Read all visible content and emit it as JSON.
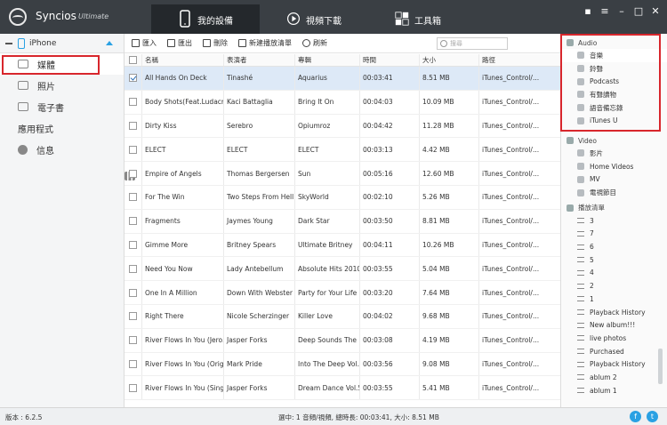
{
  "app": {
    "name": "Syncios",
    "edition": "Ultimate"
  },
  "tabs": [
    {
      "label": "我的設備",
      "icon": "phone-icon"
    },
    {
      "label": "視頻下載",
      "icon": "play-icon"
    },
    {
      "label": "工具箱",
      "icon": "toolbox-icon"
    }
  ],
  "window_controls": [
    "chat-icon",
    "menu-icon",
    "minimize-icon",
    "maximize-icon",
    "close-icon"
  ],
  "device": {
    "name": "iPhone"
  },
  "nav": [
    {
      "label": "媒體",
      "icon": "media-icon"
    },
    {
      "label": "照片",
      "icon": "photo-icon"
    },
    {
      "label": "電子書",
      "icon": "ebook-icon"
    },
    {
      "label": "應用程式",
      "icon": "apps-icon"
    },
    {
      "label": "信息",
      "icon": "info-icon"
    }
  ],
  "toolbar": {
    "import": "匯入",
    "export": "匯出",
    "delete": "刪除",
    "new_playlist": "新建播放清單",
    "refresh": "刷新"
  },
  "search": {
    "placeholder": "搜尋"
  },
  "columns": [
    "名稱",
    "表演者",
    "專輯",
    "時間",
    "大小",
    "路徑"
  ],
  "rows": [
    {
      "name": "All Hands On Deck",
      "artist": "Tinashé",
      "album": "Aquarius",
      "time": "00:03:41",
      "size": "8.51 MB",
      "path": "iTunes_Control/...",
      "checked": true
    },
    {
      "name": "Body Shots(Feat.Ludacr...",
      "artist": "Kaci Battaglia",
      "album": "Bring It On",
      "time": "00:04:03",
      "size": "10.09 MB",
      "path": "iTunes_Control/...",
      "checked": false
    },
    {
      "name": "Dirty Kiss",
      "artist": "Serebro",
      "album": "Opiumroz",
      "time": "00:04:42",
      "size": "11.28 MB",
      "path": "iTunes_Control/...",
      "checked": false
    },
    {
      "name": "ELECT",
      "artist": "ELECT",
      "album": "ELECT",
      "time": "00:03:13",
      "size": "4.42 MB",
      "path": "iTunes_Control/...",
      "checked": false
    },
    {
      "name": "Empire of Angels",
      "artist": "Thomas Bergersen",
      "album": "Sun",
      "time": "00:05:16",
      "size": "12.60 MB",
      "path": "iTunes_Control/...",
      "checked": false
    },
    {
      "name": "For The Win",
      "artist": "Two Steps From Hell",
      "album": "SkyWorld",
      "time": "00:02:10",
      "size": "5.26 MB",
      "path": "iTunes_Control/...",
      "checked": false
    },
    {
      "name": "Fragments",
      "artist": "Jaymes Young",
      "album": "Dark Star",
      "time": "00:03:50",
      "size": "8.81 MB",
      "path": "iTunes_Control/...",
      "checked": false
    },
    {
      "name": "Gimme More",
      "artist": "Britney Spears",
      "album": "Ultimate Britney",
      "time": "00:04:11",
      "size": "10.26 MB",
      "path": "iTunes_Control/...",
      "checked": false
    },
    {
      "name": "Need You Now",
      "artist": "Lady Antebellum",
      "album": "Absolute Hits 2010",
      "time": "00:03:55",
      "size": "5.04 MB",
      "path": "iTunes_Control/...",
      "checked": false
    },
    {
      "name": "One In A Million",
      "artist": "Down With Webster",
      "album": "Party for Your Life",
      "time": "00:03:20",
      "size": "7.64 MB",
      "path": "iTunes_Control/...",
      "checked": false
    },
    {
      "name": "Right There",
      "artist": "Nicole Scherzinger",
      "album": "Killer Love",
      "time": "00:04:02",
      "size": "9.68 MB",
      "path": "iTunes_Control/...",
      "checked": false
    },
    {
      "name": "River Flows In You (Jero...",
      "artist": "Jasper Forks",
      "album": "Deep Sounds The ...",
      "time": "00:03:08",
      "size": "4.19 MB",
      "path": "iTunes_Control/...",
      "checked": false
    },
    {
      "name": "River Flows In You (Orig...",
      "artist": "Mark Pride",
      "album": "Into The Deep Vol.02",
      "time": "00:03:56",
      "size": "9.08 MB",
      "path": "iTunes_Control/...",
      "checked": false
    },
    {
      "name": "River Flows In You (Sing...",
      "artist": "Jasper Forks",
      "album": "Dream Dance Vol.55",
      "time": "00:03:55",
      "size": "5.41 MB",
      "path": "iTunes_Control/...",
      "checked": false
    }
  ],
  "right": {
    "audio_title": "Audio",
    "audio_items": [
      "音樂",
      "鈴聲",
      "Podcasts",
      "有聲讀物",
      "語音備忘錄",
      "iTunes U"
    ],
    "video_title": "Video",
    "video_items": [
      "影片",
      "Home Videos",
      "MV",
      "電視節目"
    ],
    "playlist_title": "播放清單",
    "playlist_items": [
      "3",
      "7",
      "6",
      "5",
      "4",
      "2",
      "1",
      "Playback History",
      "New album!!!",
      "live photos",
      "Purchased",
      "Playback History",
      "ablum 2",
      "ablum 1"
    ]
  },
  "status": {
    "version": "版本 : 6.2.5",
    "summary": "選中: 1 音頻/視頻, 總時長: 00:03:41, 大小: 8.51 MB"
  },
  "social": [
    "facebook-icon",
    "twitter-icon"
  ],
  "colors": {
    "accent": "#2aa1e3",
    "topbar": "#3a3f44",
    "highlight": "#d8262c",
    "selection": "#dde9f7"
  }
}
